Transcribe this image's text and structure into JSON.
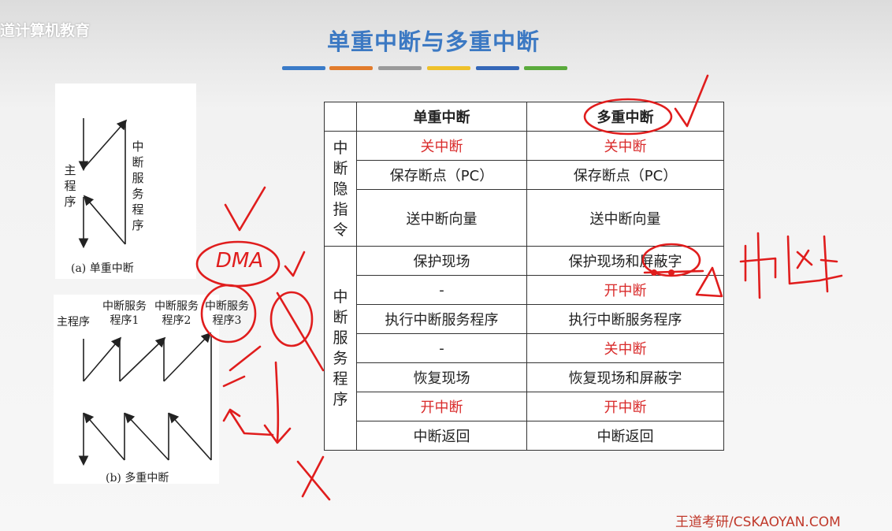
{
  "brand": {
    "name": "道计算机教育"
  },
  "title": "单重中断与多重中断",
  "accent_colors": [
    "#3a7bc8",
    "#e27c2c",
    "#9a9a9a",
    "#efc12b",
    "#3467b8",
    "#5aaa3c"
  ],
  "figure_a": {
    "main_program": "主程序",
    "isr": "中断服务程序",
    "caption": "(a) 单重中断"
  },
  "figure_b": {
    "main_program": "主程序",
    "isr1": "中断服务程序1",
    "isr2": "中断服务程序2",
    "isr3": "中断服务程序3",
    "caption": "(b) 多重中断"
  },
  "table": {
    "headers": [
      "",
      "单重中断",
      "多重中断"
    ],
    "group1_label": "中断隐指令",
    "group2_label": "中断服务程序",
    "rows": [
      {
        "single": "关中断",
        "multi": "关中断",
        "single_red": true,
        "multi_red": true
      },
      {
        "single": "保存断点（PC）",
        "multi": "保存断点（PC）"
      },
      {
        "single": "送中断向量",
        "multi": "送中断向量"
      },
      {
        "single": "保护现场",
        "multi": "保护现场和屏蔽字"
      },
      {
        "single": "-",
        "multi": "开中断",
        "multi_red": true
      },
      {
        "single": "执行中断服务程序",
        "multi": "执行中断服务程序"
      },
      {
        "single": "-",
        "multi": "关中断",
        "multi_red": true
      },
      {
        "single": "恢复现场",
        "multi": "恢复现场和屏蔽字"
      },
      {
        "single": "开中断",
        "multi": "开中断",
        "single_red": true,
        "multi_red": true
      },
      {
        "single": "中断返回",
        "multi": "中断返回"
      }
    ]
  },
  "annotations": {
    "dma": "DMA",
    "handwritten_interrupt": "中断"
  },
  "footer": "王道考研/CSKAOYAN.COM"
}
